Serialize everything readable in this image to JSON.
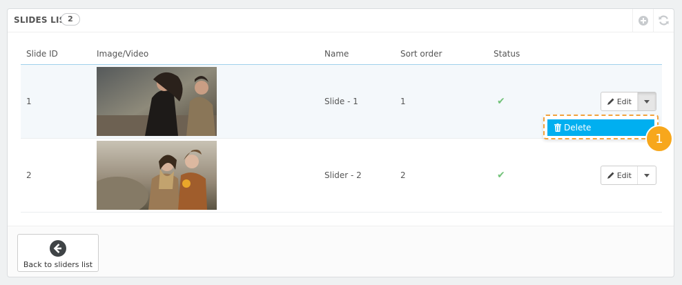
{
  "panel": {
    "title": "SLIDES LIST",
    "count": "2"
  },
  "toolbar": {
    "add_icon": "plus-circle-icon",
    "refresh_icon": "refresh-icon"
  },
  "table": {
    "columns": [
      "Slide ID",
      "Image/Video",
      "Name",
      "Sort order",
      "Status",
      ""
    ],
    "rows": [
      {
        "id": "1",
        "name": "Slide - 1",
        "sort": "1",
        "status": "✔",
        "action": "Edit"
      },
      {
        "id": "2",
        "name": "Slider - 2",
        "sort": "2",
        "status": "✔",
        "action": "Edit"
      }
    ]
  },
  "dropdown": {
    "item": "Delete",
    "step": "1"
  },
  "footer": {
    "back_label": "Back to sliders list"
  },
  "colors": {
    "accent": "#00aff0",
    "badge": "#f7a71c",
    "check": "#72c279"
  }
}
